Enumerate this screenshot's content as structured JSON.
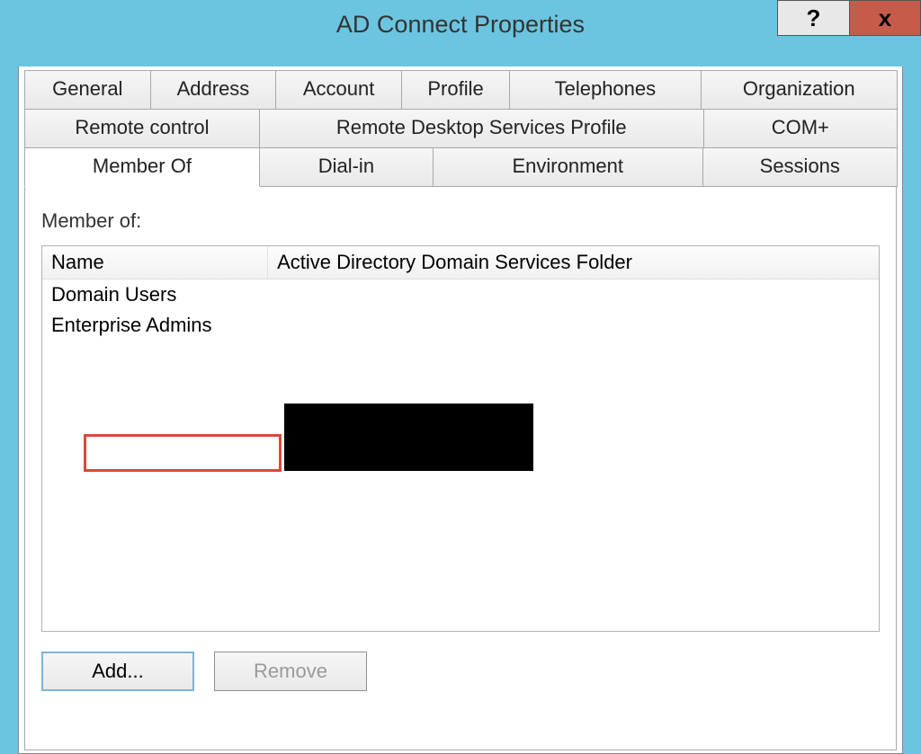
{
  "titlebar": {
    "title": "AD Connect Properties"
  },
  "tabs": {
    "row1": [
      "General",
      "Address",
      "Account",
      "Profile",
      "Telephones",
      "Organization"
    ],
    "row2": [
      "Remote control",
      "Remote Desktop Services Profile",
      "COM+"
    ],
    "row3": [
      "Member Of",
      "Dial-in",
      "Environment",
      "Sessions"
    ],
    "active": "Member Of"
  },
  "memberof": {
    "section_label": "Member of:",
    "columns": {
      "name": "Name",
      "folder": "Active Directory Domain Services Folder"
    },
    "rows": [
      {
        "name": "Domain Users",
        "folder": ""
      },
      {
        "name": "Enterprise Admins",
        "folder": ""
      }
    ]
  },
  "buttons": {
    "add": "Add...",
    "remove": "Remove"
  }
}
